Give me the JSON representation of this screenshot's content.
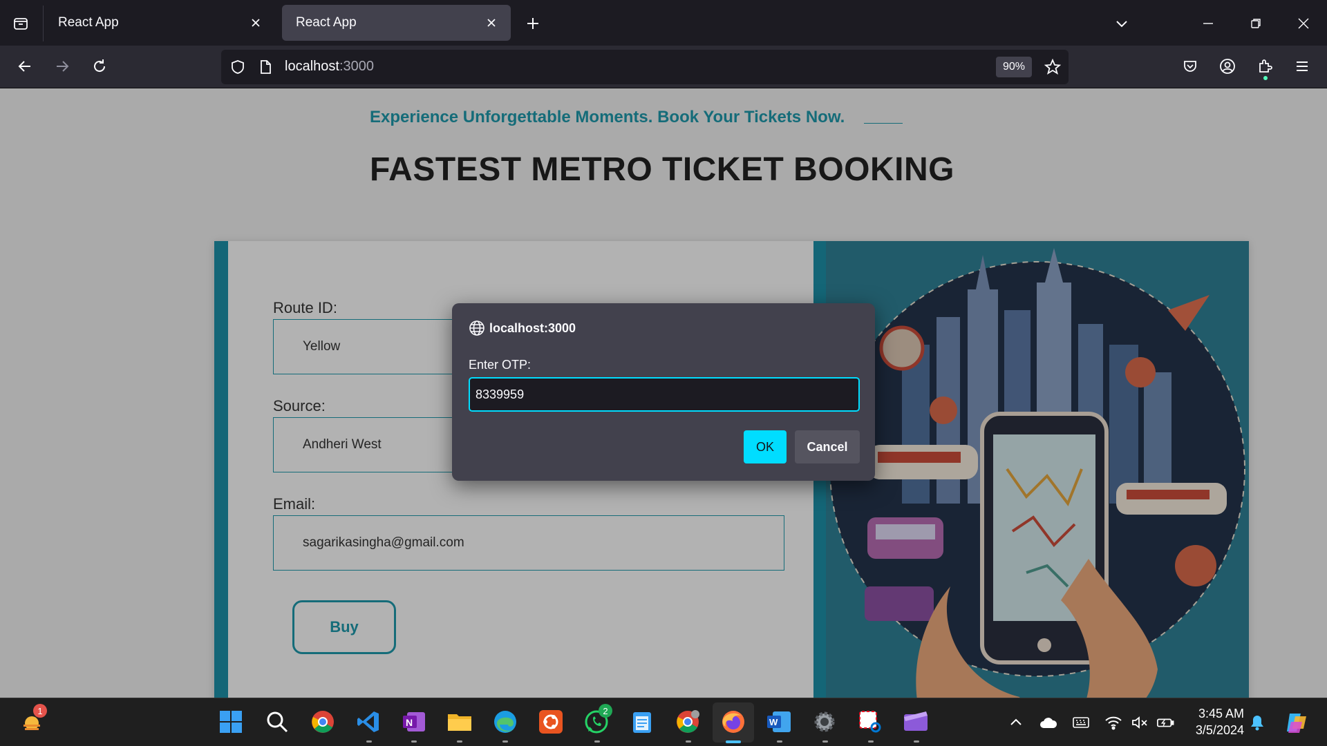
{
  "browser": {
    "tabs": [
      {
        "title": "React App",
        "active": false
      },
      {
        "title": "React App",
        "active": true
      }
    ],
    "url_host": "localhost",
    "url_port": ":3000",
    "zoom": "90%"
  },
  "page": {
    "tagline": "Experience Unforgettable Moments. Book Your Tickets Now.",
    "headline": "FASTEST METRO TICKET BOOKING",
    "form": {
      "route_label": "Route ID:",
      "route_value": "Yellow",
      "source_label": "Source:",
      "source_value": "Andheri West",
      "email_label": "Email:",
      "email_value": "sagarikasingha@gmail.com",
      "buy_label": "Buy"
    }
  },
  "dialog": {
    "origin": "localhost:3000",
    "message": "Enter OTP:",
    "input_value": "8339959",
    "ok_label": "OK",
    "cancel_label": "Cancel"
  },
  "taskbar": {
    "weather_badge": "1",
    "whatsapp_badge": "2",
    "time": "3:45 AM",
    "date": "3/5/2024"
  },
  "colors": {
    "accent": "#1e96a8",
    "dialog_focus": "#00ddff",
    "browser_bg": "#1c1b22"
  }
}
